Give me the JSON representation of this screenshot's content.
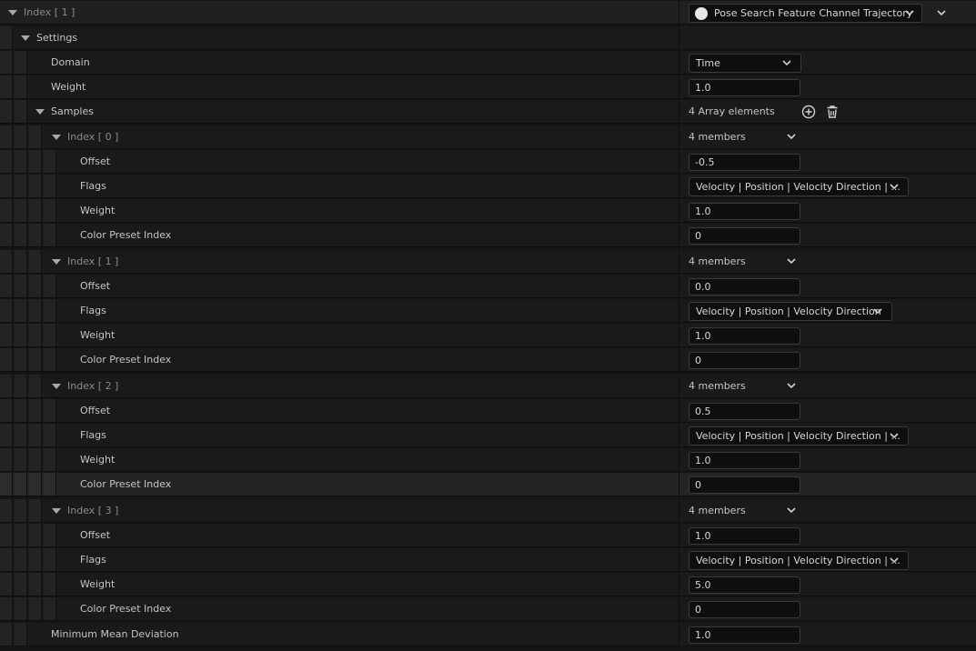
{
  "header": {
    "label": "Index [ 1 ]",
    "channel_type": "Pose Search Feature Channel Trajectory"
  },
  "settings": {
    "label": "Settings",
    "domain": {
      "label": "Domain",
      "value": "Time"
    },
    "weight": {
      "label": "Weight",
      "value": "1.0"
    },
    "samples": {
      "label": "Samples",
      "count_text": "4 Array elements",
      "items": [
        {
          "index": "Index [ 0 ]",
          "members": "4 members",
          "offset_label": "Offset",
          "offset": "-0.5",
          "flags_label": "Flags",
          "flags": "Velocity | Position | Velocity Direction | ...",
          "weight_label": "Weight",
          "weight": "1.0",
          "color_label": "Color Preset Index",
          "color": "0"
        },
        {
          "index": "Index [ 1 ]",
          "members": "4 members",
          "offset_label": "Offset",
          "offset": "0.0",
          "flags_label": "Flags",
          "flags": "Velocity | Position | Velocity Direction",
          "weight_label": "Weight",
          "weight": "1.0",
          "color_label": "Color Preset Index",
          "color": "0"
        },
        {
          "index": "Index [ 2 ]",
          "members": "4 members",
          "offset_label": "Offset",
          "offset": "0.5",
          "flags_label": "Flags",
          "flags": "Velocity | Position | Velocity Direction | ...",
          "weight_label": "Weight",
          "weight": "1.0",
          "color_label": "Color Preset Index",
          "color": "0"
        },
        {
          "index": "Index [ 3 ]",
          "members": "4 members",
          "offset_label": "Offset",
          "offset": "1.0",
          "flags_label": "Flags",
          "flags": "Velocity | Position | Velocity Direction | ...",
          "weight_label": "Weight",
          "weight": "5.0",
          "color_label": "Color Preset Index",
          "color": "0"
        }
      ]
    },
    "min_mean_dev": {
      "label": "Minimum Mean Deviation",
      "value": "1.0"
    }
  },
  "colors": {
    "panel_bg": "#1a1a1a",
    "field_bg": "#0f0f0f",
    "text": "#c4c4c4"
  }
}
